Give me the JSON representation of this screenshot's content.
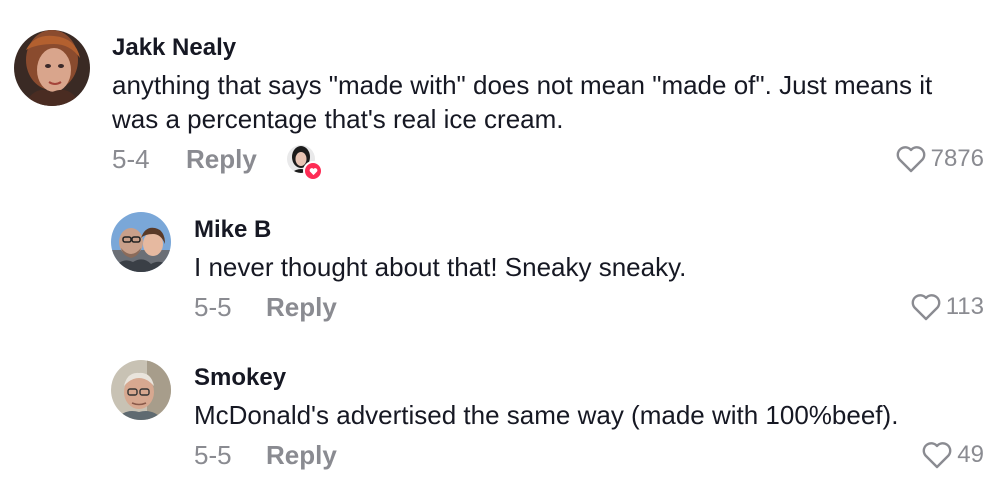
{
  "comments": [
    {
      "username": "Jakk Nealy",
      "text_line1": "anything that says \"made with\" does not mean \"made of\". Just means it",
      "text_line2": "was a percentage that's real ice cream.",
      "date": "5-4",
      "reply_label": "Reply",
      "likes": "7876",
      "creator_liked": true,
      "avatar_icon": "user-avatar-woman-red-hair"
    },
    {
      "username": "Mike B",
      "text_line1": "I never thought about that! Sneaky sneaky.",
      "date": "5-5",
      "reply_label": "Reply",
      "likes": "113",
      "avatar_icon": "user-avatar-man-glasses-with-child"
    },
    {
      "username": "Smokey",
      "text_line1": "McDonald's advertised the same way (made with 100%beef).",
      "date": "5-5",
      "reply_label": "Reply",
      "likes": "49",
      "avatar_icon": "user-avatar-older-man"
    }
  ],
  "colors": {
    "text_primary": "#161823",
    "text_secondary": "#8a8b91",
    "like_badge": "#fe2c55"
  }
}
